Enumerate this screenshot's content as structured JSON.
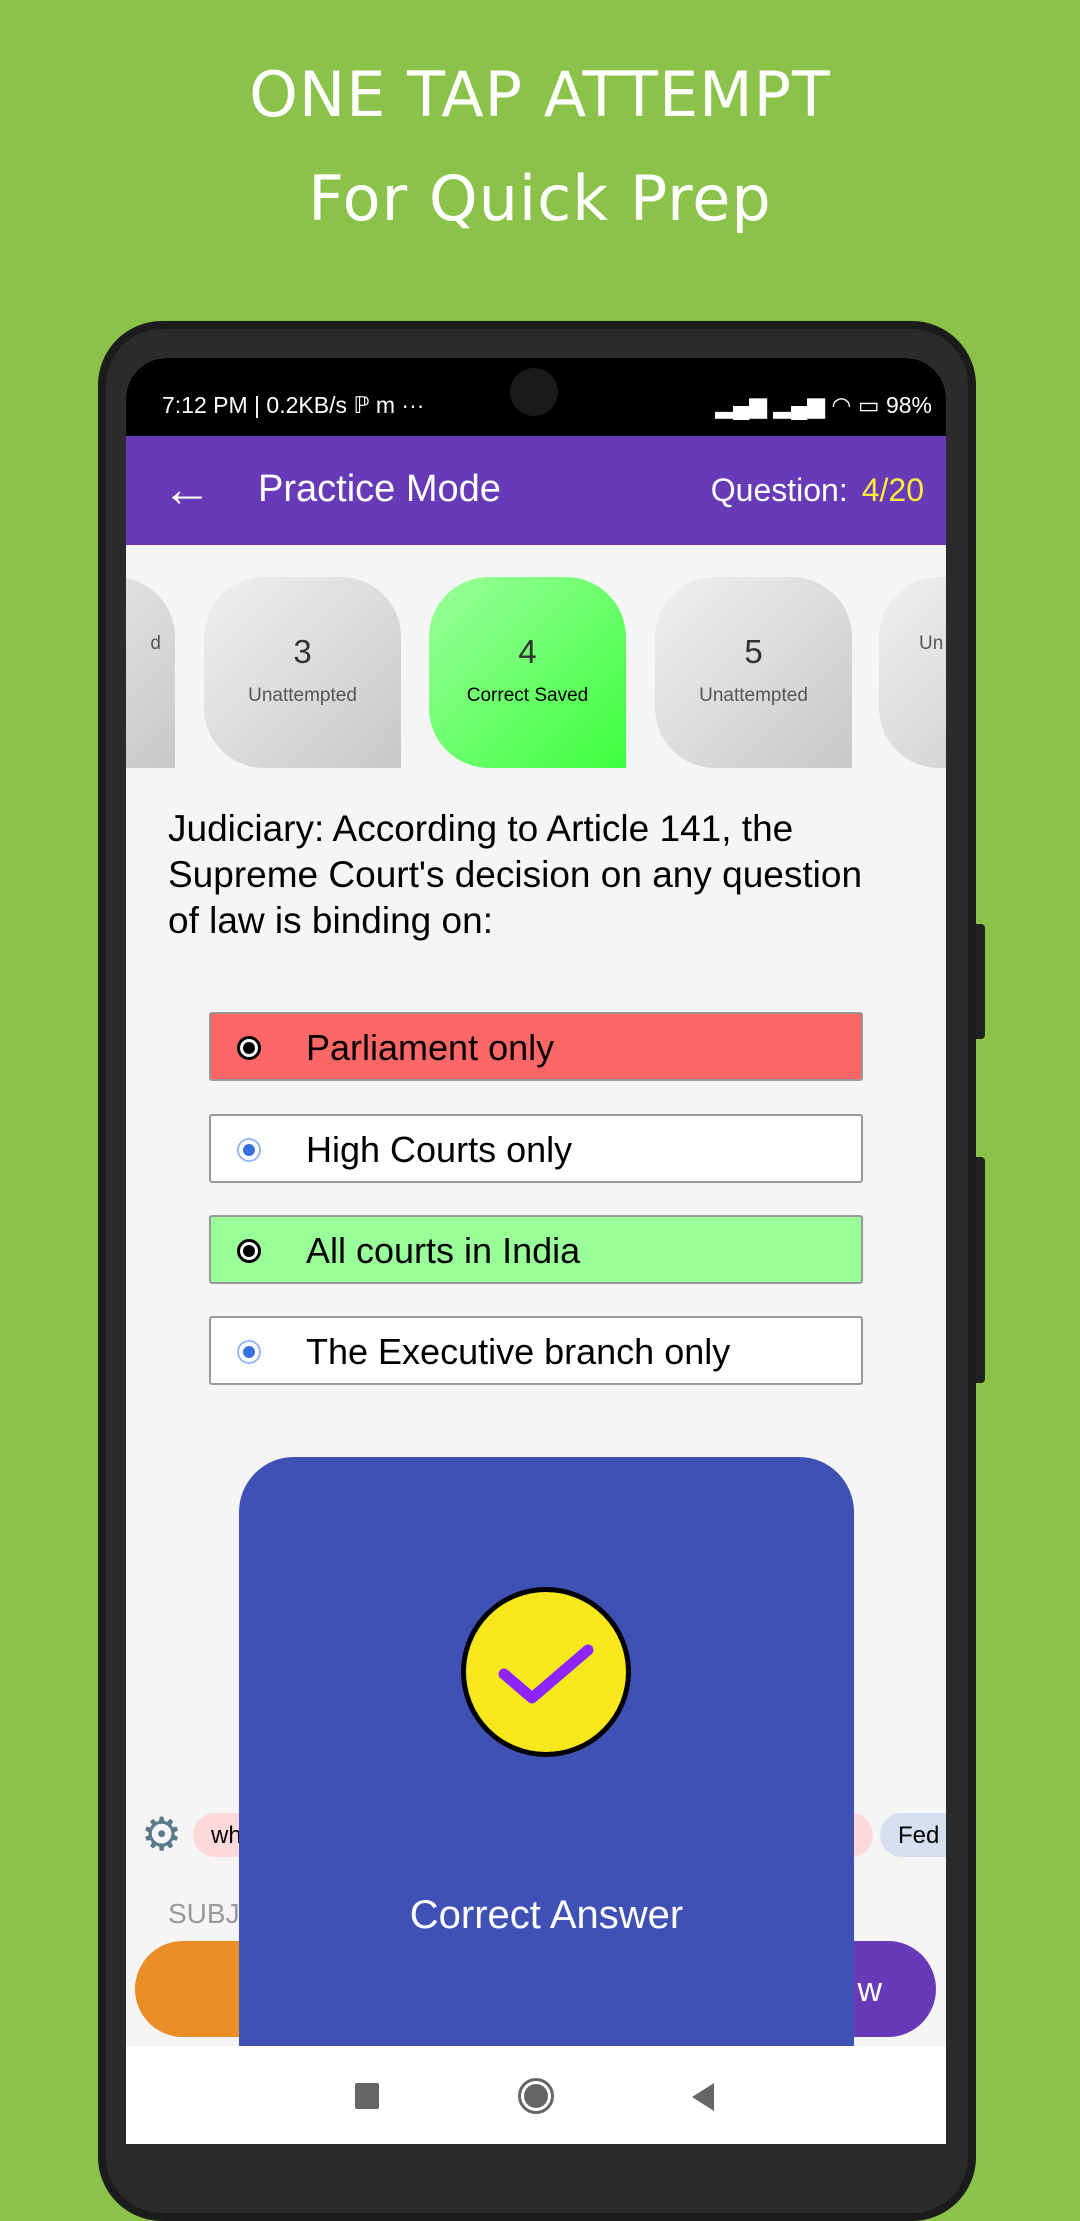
{
  "promo": {
    "line1": "ONE TAP ATTEMPT",
    "line2": "For Quick Prep"
  },
  "status_bar": {
    "left": "7:12 PM | 0.2KB/s ℙ m  ···",
    "right": "▂▄▆ ▂▄▆ ◠ ▭ 98%"
  },
  "app_bar": {
    "back_icon": "←",
    "title": "Practice Mode",
    "question_label": "Question:",
    "question_progress": "4/20"
  },
  "question_nav": [
    {
      "number": "",
      "status": "d"
    },
    {
      "number": "3",
      "status": "Unattempted"
    },
    {
      "number": "4",
      "status": "Correct Saved"
    },
    {
      "number": "5",
      "status": "Unattempted"
    },
    {
      "number": "",
      "status": "Un"
    }
  ],
  "question": "Judiciary: According to Article 141, the Supreme Court's decision on any question of law is binding on:",
  "options": [
    {
      "text": "Parliament only",
      "state": "wrong",
      "color": "#ff6666"
    },
    {
      "text": "High Courts only",
      "state": "none"
    },
    {
      "text": "All courts in India",
      "state": "correct",
      "color": "#99ff99"
    },
    {
      "text": "The Executive branch only",
      "state": "none"
    }
  ],
  "tags": {
    "settings_icon": "gear-icon",
    "chip1": "wh",
    "chip2": "Fed"
  },
  "subject_label": "SUBJ",
  "buttons": {
    "right_partial": "w"
  },
  "dialog": {
    "label": "Correct Answer",
    "icon": "check-icon",
    "bg": "#3f51b5",
    "icon_bg": "#f7e81e"
  }
}
